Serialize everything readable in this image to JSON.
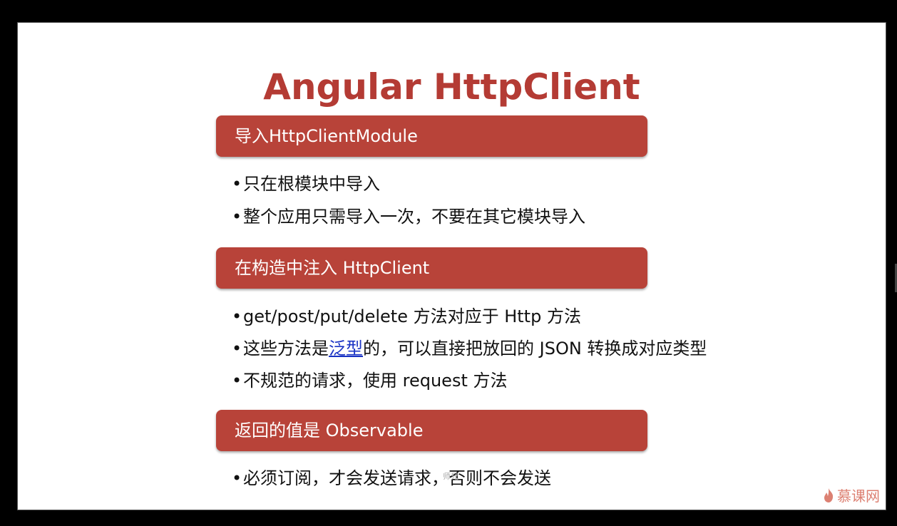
{
  "title": "Angular HttpClient",
  "sections": [
    {
      "heading": "导入HttpClientModule",
      "bullets": [
        "只在根模块中导入",
        "整个应用只需导入一次，不要在其它模块导入"
      ]
    },
    {
      "heading": "在构造中注入 HttpClient",
      "bullets": [
        "get/post/put/delete 方法对应于 Http 方法",
        {
          "pre": "这些方法是",
          "link": "泛型",
          "post": "的，可以直接把放回的 JSON 转换成对应类型"
        },
        "不规范的请求，使用 request 方法"
      ]
    },
    {
      "heading": "返回的值是 Observable",
      "bullets": [
        "必须订阅，才会发送请求，否则不会发送"
      ]
    }
  ],
  "watermark_overlay": "师兄",
  "logo": {
    "text": "慕课网",
    "icon": "flame-icon"
  },
  "colors": {
    "title": "#b43b34",
    "section_bar": "#b84339",
    "link": "#1a33c4",
    "logo": "#d76a5a"
  },
  "bullet_symbol": "•"
}
